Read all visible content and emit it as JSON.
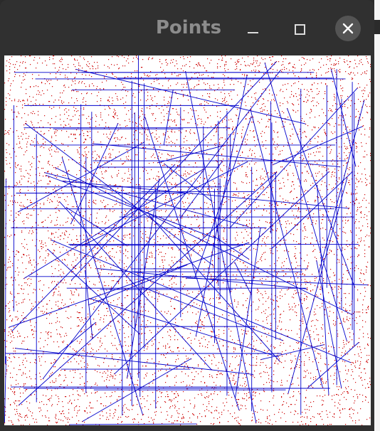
{
  "window": {
    "title": "Points",
    "controls": {
      "minimize": "minimize-icon",
      "maximize": "maximize-icon",
      "close": "close-icon"
    }
  },
  "canvas": {
    "background": "#ffffff",
    "point_color": "#d01010",
    "line_color": "#0000cc"
  }
}
